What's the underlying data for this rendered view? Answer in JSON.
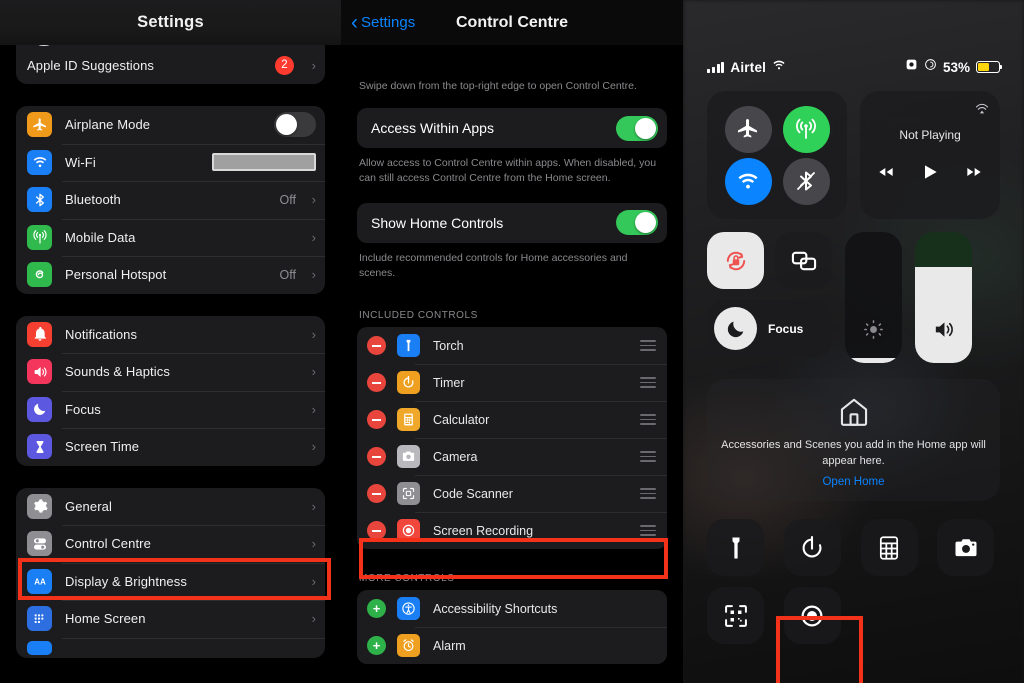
{
  "settings_panel": {
    "nav_title": "Settings",
    "avatar_name": "avatar",
    "apple_id_row": {
      "label": "Apple ID Suggestions",
      "badge": "2",
      "chevron": "›"
    },
    "groups": [
      {
        "name": "connectivity",
        "rows": [
          {
            "label": "Airplane Mode",
            "icon": "airplane-icon",
            "color": "#f09a1b",
            "control": "switch",
            "value": "off"
          },
          {
            "label": "Wi-Fi",
            "icon": "wifi-icon",
            "color": "#1a7ef5",
            "control": "redacted",
            "value": ""
          },
          {
            "label": "Bluetooth",
            "icon": "bluetooth-icon",
            "color": "#1a7ef5",
            "control": "value",
            "value": "Off"
          },
          {
            "label": "Mobile Data",
            "icon": "cellular-icon",
            "color": "#30b94d",
            "control": "value",
            "value": ""
          },
          {
            "label": "Personal Hotspot",
            "icon": "hotspot-icon",
            "color": "#30b94d",
            "control": "value",
            "value": "Off"
          }
        ]
      },
      {
        "name": "alerts",
        "rows": [
          {
            "label": "Notifications",
            "icon": "bell-icon",
            "color": "#f53f30",
            "control": "value",
            "value": ""
          },
          {
            "label": "Sounds & Haptics",
            "icon": "speaker-icon",
            "color": "#f4365c",
            "control": "value",
            "value": ""
          },
          {
            "label": "Focus",
            "icon": "moon-icon",
            "color": "#5c58df",
            "control": "value",
            "value": ""
          },
          {
            "label": "Screen Time",
            "icon": "hourglass-icon",
            "color": "#5c58df",
            "control": "value",
            "value": ""
          }
        ]
      },
      {
        "name": "system",
        "rows": [
          {
            "label": "General",
            "icon": "gear-icon",
            "color": "#8e8e93",
            "control": "value",
            "value": ""
          },
          {
            "label": "Control Centre",
            "icon": "control-centre-icon",
            "color": "#8e8e93",
            "control": "value",
            "value": "",
            "highlighted": true
          },
          {
            "label": "Display & Brightness",
            "icon": "display-text-icon",
            "color": "#1a7ef5",
            "control": "value",
            "value": ""
          },
          {
            "label": "Home Screen",
            "icon": "home-screen-icon",
            "color": "#2d6ee0",
            "control": "value",
            "value": ""
          }
        ]
      }
    ]
  },
  "control_centre_settings": {
    "back_label": "Settings",
    "nav_title": "Control Centre",
    "intro_text": "Swipe down from the top-right edge to open Control Centre.",
    "toggles": [
      {
        "label": "Access Within Apps",
        "state": "on",
        "footer": "Allow access to Control Centre within apps. When disabled, you can still access Control Centre from the Home screen."
      },
      {
        "label": "Show Home Controls",
        "state": "on",
        "footer": "Include recommended controls for Home accessories and scenes."
      }
    ],
    "included_header": "INCLUDED CONTROLS",
    "included": [
      {
        "label": "Torch",
        "icon": "torch-icon",
        "color": "#1a7ef5"
      },
      {
        "label": "Timer",
        "icon": "timer-icon",
        "color": "#f0a020"
      },
      {
        "label": "Calculator",
        "icon": "calculator-icon",
        "color": "#f0a82a"
      },
      {
        "label": "Camera",
        "icon": "camera-icon",
        "color": "#b8b8bd"
      },
      {
        "label": "Code Scanner",
        "icon": "code-scanner-icon",
        "color": "#8e8e93"
      },
      {
        "label": "Screen Recording",
        "icon": "screen-recording-icon",
        "color": "#f0463c",
        "highlighted": true
      }
    ],
    "more_header": "MORE CONTROLS",
    "more": [
      {
        "label": "Accessibility Shortcuts",
        "icon": "accessibility-icon",
        "color": "#1a7ef5"
      },
      {
        "label": "Alarm",
        "icon": "alarm-icon",
        "color": "#f0a020"
      }
    ]
  },
  "control_centre": {
    "status": {
      "carrier": "Airtel",
      "battery_percent": "53%",
      "battery_level": 53,
      "battery_color": "#ffd60a",
      "signal_bars": 4
    },
    "connectivity": [
      {
        "name": "airplane-mode",
        "icon": "airplane-icon",
        "state": "off"
      },
      {
        "name": "mobile-data",
        "icon": "cellular-icon",
        "state": "on"
      },
      {
        "name": "wifi",
        "icon": "wifi-icon",
        "state": "on"
      },
      {
        "name": "bluetooth",
        "icon": "bluetooth-off-icon",
        "state": "off"
      }
    ],
    "media": {
      "title": "Not Playing",
      "airplay": "airplay-icon"
    },
    "rotation_lock": {
      "icon": "rotation-lock-icon",
      "state": "on"
    },
    "screen_mirroring": {
      "icon": "screen-mirroring-icon",
      "state": "off"
    },
    "focus": {
      "label": "Focus",
      "icon": "moon-icon"
    },
    "brightness": {
      "icon": "brightness-icon",
      "level": 4
    },
    "volume": {
      "icon": "volume-icon",
      "level": 73
    },
    "home_card": {
      "icon": "home-icon",
      "text": "Accessories and Scenes you add in the Home app will appear here.",
      "link": "Open Home"
    },
    "apps": [
      {
        "name": "torch",
        "icon": "torch-icon"
      },
      {
        "name": "timer",
        "icon": "timer-icon"
      },
      {
        "name": "calculator",
        "icon": "calculator-icon"
      },
      {
        "name": "camera",
        "icon": "camera-icon"
      },
      {
        "name": "code-scanner",
        "icon": "code-scanner-icon"
      },
      {
        "name": "screen-recording",
        "icon": "screen-recording-icon",
        "highlighted": true
      }
    ]
  },
  "annotations": {
    "highlight_color": "#f4321a",
    "count": 3
  }
}
